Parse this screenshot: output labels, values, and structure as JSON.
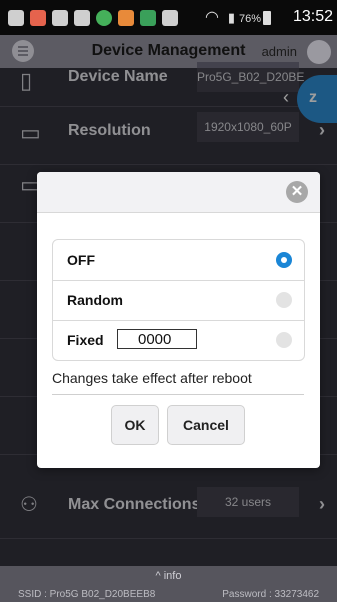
{
  "status_bar": {
    "battery_pct": "76%",
    "time": "13:52"
  },
  "header": {
    "title": "Device Management",
    "user": "admin"
  },
  "settings": {
    "rows": [
      {
        "label": "Device Name",
        "value": "Pro5G_B02_D20BE"
      },
      {
        "label": "Resolution",
        "value": "1920x1080_60P"
      },
      {
        "label": "",
        "value": ""
      },
      {
        "label": "",
        "value": ""
      },
      {
        "label": "",
        "value": ""
      },
      {
        "label": "",
        "value": ""
      },
      {
        "label": "",
        "value": ""
      },
      {
        "label": "Max Connections",
        "value": "32 users"
      }
    ]
  },
  "modal": {
    "options": [
      {
        "label": "OFF",
        "selected": true
      },
      {
        "label": "Random",
        "selected": false
      },
      {
        "label": "Fixed",
        "selected": false
      }
    ],
    "fixed_value": "0000",
    "note": "Changes take effect after reboot",
    "ok_label": "OK",
    "cancel_label": "Cancel",
    "close_glyph": "✕"
  },
  "bottom": {
    "info_label": "^ info",
    "ssid": "SSID : Pro5G B02_D20BEEB8",
    "password": "Password : 33273462"
  },
  "colors": {
    "accent": "#1a86d6",
    "background": "#33323d"
  }
}
